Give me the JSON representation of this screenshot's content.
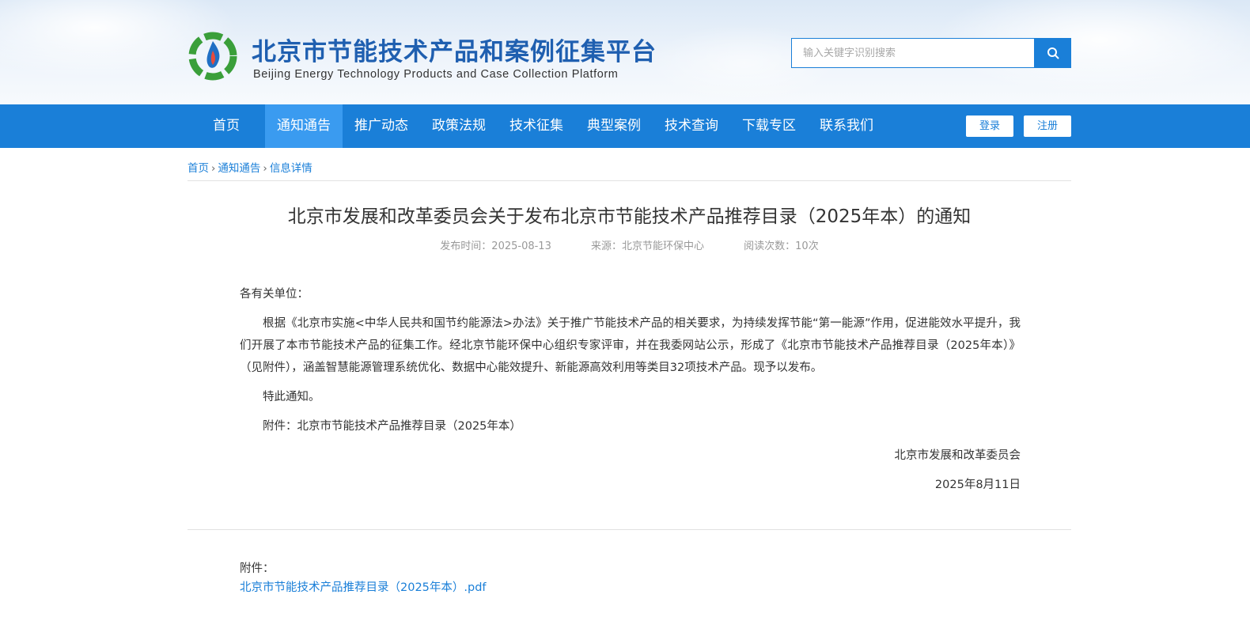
{
  "header": {
    "title_cn": "北京市节能技术产品和案例征集平台",
    "title_en": "Beijing Energy Technology Products and Case Collection Platform",
    "search": {
      "placeholder": "输入关键字识别搜索",
      "value": ""
    },
    "search_icon": "search-icon"
  },
  "nav": {
    "items": [
      {
        "label": "首页",
        "active": false
      },
      {
        "label": "通知通告",
        "active": true
      },
      {
        "label": "推广动态",
        "active": false
      },
      {
        "label": "政策法规",
        "active": false
      },
      {
        "label": "技术征集",
        "active": false
      },
      {
        "label": "典型案例",
        "active": false
      },
      {
        "label": "技术查询",
        "active": false
      },
      {
        "label": "下载专区",
        "active": false
      },
      {
        "label": "联系我们",
        "active": false
      }
    ],
    "login_label": "登录",
    "register_label": "注册"
  },
  "breadcrumb": [
    "首页",
    "通知通告",
    "信息详情"
  ],
  "article": {
    "title": "北京市发展和改革委员会关于发布北京市节能技术产品推荐目录（2025年本）的通知",
    "meta": {
      "publish_time": "发布时间：2025-08-13",
      "source": "来源：北京节能环保中心",
      "reads": "阅读次数：10次"
    },
    "salutation": "各有关单位：",
    "paragraph1": "根据《北京市实施<中华人民共和国节约能源法>办法》关于推广节能技术产品的相关要求，为持续发挥节能“第一能源”作用，促进能效水平提升，我们开展了本市节能技术产品的征集工作。经北京节能环保中心组织专家评审，并在我委网站公示，形成了《北京市节能技术产品推荐目录（2025年本）》（见附件），涵盖智慧能源管理系统优化、数据中心能效提升、新能源高效利用等类目32项技术产品。现予以发布。",
    "paragraph2": "特此通知。",
    "paragraph3": "附件：北京市节能技术产品推荐目录（2025年本）",
    "signature": "北京市发展和改革委员会",
    "date": "2025年8月11日"
  },
  "attachments": {
    "label": "附件：",
    "files": [
      "北京市节能技术产品推荐目录（2025年本）.pdf"
    ]
  },
  "colors": {
    "primary": "#1a7fd8",
    "nav_active": "#3a9bf0",
    "logo_text": "#1f5fb0"
  }
}
